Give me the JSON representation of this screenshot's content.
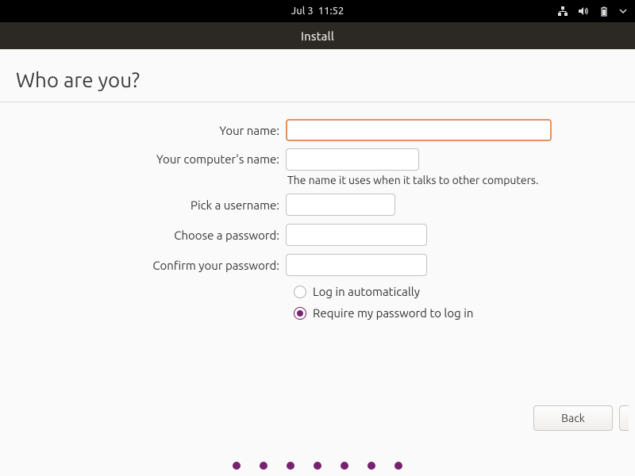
{
  "topbar": {
    "date": "Jul 3",
    "time": "11:52"
  },
  "window": {
    "title": "Install"
  },
  "page": {
    "heading": "Who are you?"
  },
  "labels": {
    "your_name": "Your name:",
    "computer_name": "Your computer's name:",
    "computer_hint": "The name it uses when it talks to other computers.",
    "username": "Pick a username:",
    "password": "Choose a password:",
    "confirm": "Confirm your password:"
  },
  "fields": {
    "your_name": "",
    "computer_name": "",
    "username": "",
    "password": "",
    "confirm": ""
  },
  "login_options": {
    "auto": "Log in automatically",
    "require": "Require my password to log in",
    "selected": "require"
  },
  "buttons": {
    "back": "Back"
  },
  "colors": {
    "accent": "#77216f",
    "focus_border": "#e39160"
  }
}
